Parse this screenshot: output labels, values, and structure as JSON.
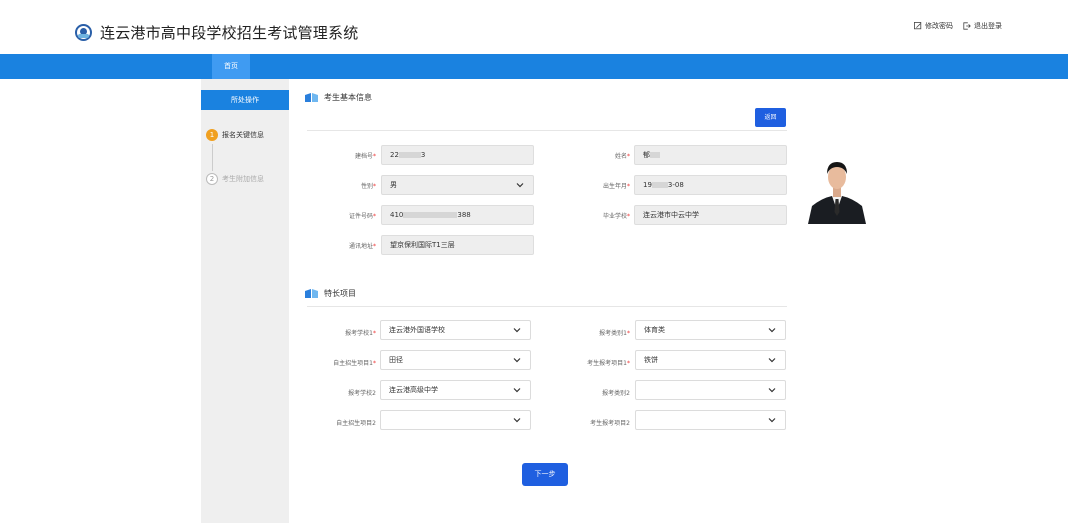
{
  "header": {
    "title": "连云港市高中段学校招生考试管理系统",
    "change_password": "修改密码",
    "logout": "退出登录"
  },
  "nav": {
    "home_tab": "首页"
  },
  "sidebar": {
    "title": "所处操作",
    "steps": [
      {
        "num": "1",
        "label": "报名关键信息"
      },
      {
        "num": "2",
        "label": "考生附加信息"
      }
    ]
  },
  "basic": {
    "title": "考生基本信息",
    "back_button": "返回",
    "fields": {
      "archive_no": {
        "label": "建档号",
        "prefix": "22",
        "suffix": "3"
      },
      "name": {
        "label": "姓名",
        "value": "郁"
      },
      "gender": {
        "label": "性别",
        "value": "男"
      },
      "birth": {
        "label": "出生年月",
        "prefix": "19",
        "suffix": "3-08"
      },
      "id_no": {
        "label": "证件号码",
        "prefix": "410",
        "suffix": "388"
      },
      "school": {
        "label": "毕业学校",
        "value": "连云港市中云中学"
      },
      "address": {
        "label": "通讯地址",
        "value": "望京保利国际T1三层"
      }
    }
  },
  "special": {
    "title": "特长项目",
    "fields": [
      {
        "label": "报考学校1",
        "required": true,
        "value": "连云港外国语学校"
      },
      {
        "label": "报考类别1",
        "required": true,
        "value": "体育类"
      },
      {
        "label": "自主招生项目1",
        "required": true,
        "value": "田径"
      },
      {
        "label": "考生报考项目1",
        "required": true,
        "value": "铁饼"
      },
      {
        "label": "报考学校2",
        "required": false,
        "value": "连云港高级中学"
      },
      {
        "label": "报考类别2",
        "required": false,
        "value": ""
      },
      {
        "label": "自主招生项目2",
        "required": false,
        "value": ""
      },
      {
        "label": "考生报考项目2",
        "required": false,
        "value": ""
      }
    ]
  },
  "next_button": "下一步",
  "colors": {
    "nav_blue": "#1a82e0",
    "button_blue": "#1f5fe0",
    "step_active": "#f0a020",
    "required": "#e33333"
  }
}
